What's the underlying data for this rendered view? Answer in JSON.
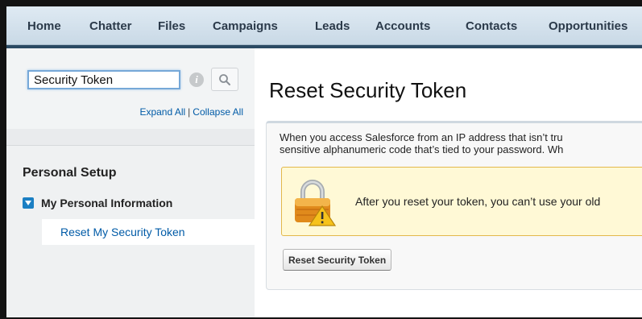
{
  "nav": {
    "items": [
      {
        "label": "Home"
      },
      {
        "label": "Chatter"
      },
      {
        "label": "Files"
      },
      {
        "label": "Campaigns"
      },
      {
        "label": "Leads"
      },
      {
        "label": "Accounts"
      },
      {
        "label": "Contacts"
      },
      {
        "label": "Opportunities"
      }
    ]
  },
  "sidebar": {
    "search": {
      "value": "Security Token",
      "info_icon": "info-icon",
      "search_icon": "search-icon"
    },
    "expand_all": "Expand All",
    "separator": "|",
    "collapse_all": "Collapse All",
    "section_title": "Personal Setup",
    "group": {
      "label": "My Personal Information",
      "icon": "collapse-icon",
      "items": [
        {
          "label": "Reset My Security Token"
        }
      ]
    }
  },
  "main": {
    "title": "Reset Security Token",
    "description_line1": "When you access Salesforce from an IP address that isn’t tru",
    "description_line2": "sensitive alphanumeric code that’s tied to your password. Wh",
    "warning": {
      "icon": "lock-warning-icon",
      "text": "After you reset your token, you can’t use your old"
    },
    "reset_button": "Reset Security Token"
  },
  "colors": {
    "link": "#015ba7",
    "nav_bg": "#d3e0eb",
    "warning_bg": "#fff9d6",
    "warning_border": "#e3b84b"
  }
}
